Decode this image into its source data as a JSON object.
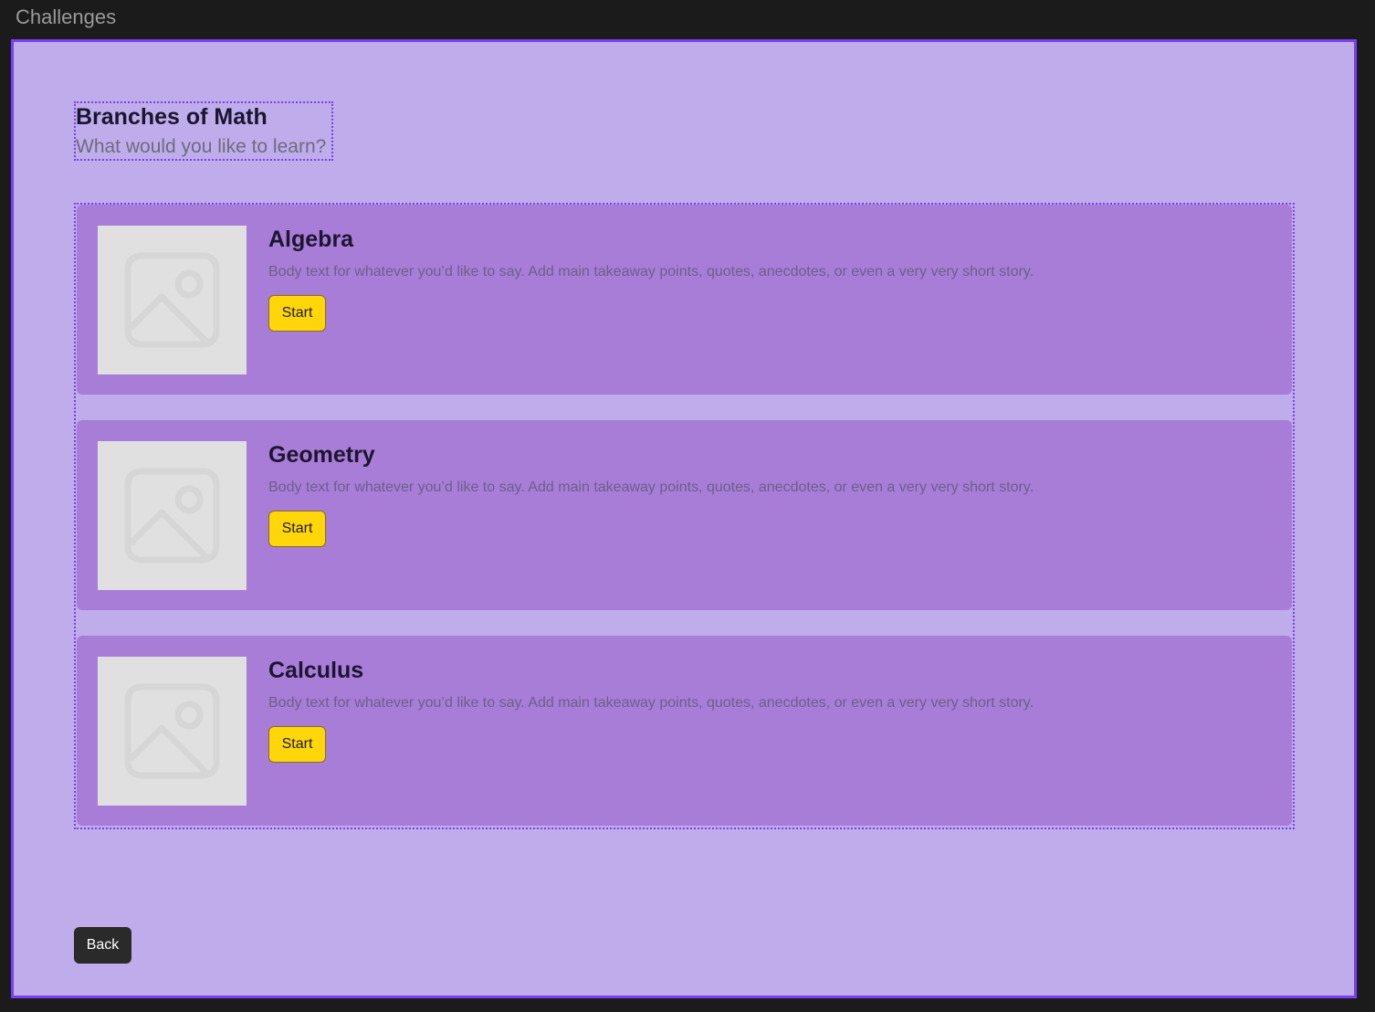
{
  "window": {
    "title": "Challenges"
  },
  "header": {
    "title": "Branches of Math",
    "subtitle": "What would you like to learn?"
  },
  "cards": [
    {
      "title": "Algebra",
      "body": "Body text for whatever you’d like to say. Add main takeaway points, quotes, anecdotes, or even a very very short story.",
      "button_label": "Start",
      "image_icon": "image-placeholder-icon"
    },
    {
      "title": "Geometry",
      "body": "Body text for whatever you’d like to say. Add main takeaway points, quotes, anecdotes, or even a very very short story.",
      "button_label": "Start",
      "image_icon": "image-placeholder-icon"
    },
    {
      "title": "Calculus",
      "body": "Body text for whatever you’d like to say. Add main takeaway points, quotes, anecdotes, or even a very very short story.",
      "button_label": "Start",
      "image_icon": "image-placeholder-icon"
    }
  ],
  "footer": {
    "back_label": "Back"
  },
  "colors": {
    "frame_border": "#7b3ff2",
    "frame_background": "#bfacea",
    "card_background": "#a77dd7",
    "start_button": "#ffd60a",
    "back_button": "#2a2a2a"
  }
}
